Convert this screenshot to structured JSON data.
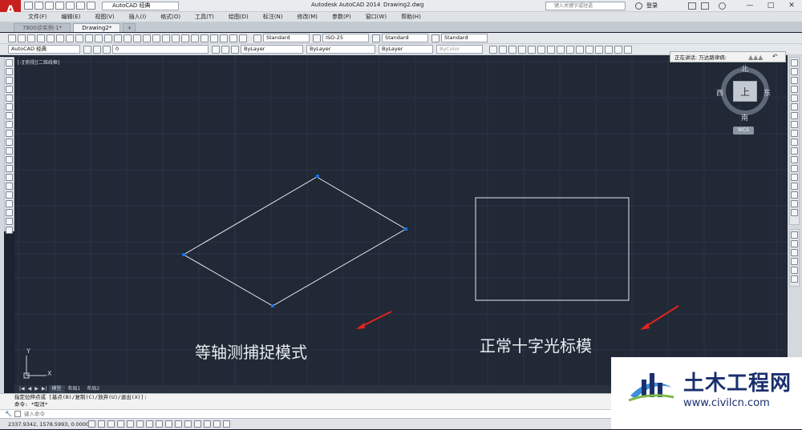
{
  "window": {
    "app_title": "Autodesk AutoCAD 2014",
    "file_title": "Drawing2.dwg",
    "logo_letter": "A",
    "workspace": "AutoCAD 经典",
    "search_placeholder": "键入关键字或短语",
    "login": "登录",
    "controls": {
      "minimize": "—",
      "maximize": "□",
      "close": "✕"
    }
  },
  "menu": {
    "items": [
      "文件(F)",
      "编辑(E)",
      "视图(V)",
      "插入(I)",
      "格式(O)",
      "工具(T)",
      "绘图(D)",
      "标注(N)",
      "修改(M)",
      "参数(P)",
      "窗口(W)",
      "帮助(H)"
    ]
  },
  "tabs": {
    "items": [
      {
        "label": "7800诊实例-1*",
        "active": false
      },
      {
        "label": "Drawing2*",
        "active": true
      }
    ]
  },
  "toolbar_styles": {
    "text_style": "Standard",
    "dim_style": "ISO-25",
    "table_style": "Standard",
    "mleader_style": "Standard"
  },
  "toolbar_layers": {
    "workspace": "AutoCAD 经典",
    "layer": "0",
    "color": "ByLayer",
    "linetype": "ByLayer",
    "lineweight": "ByLayer",
    "plotstyle": "ByColor",
    "dim_scale": "ISO-25"
  },
  "canvas": {
    "viewport_label": "[-][俯视][二维线框]",
    "background": "#212836",
    "line_color": "#e6e9ee",
    "grip_color": "#1e6fd6"
  },
  "viewcube": {
    "north": "北",
    "south": "南",
    "east": "东",
    "west": "西",
    "top": "上",
    "wcs": "WCS"
  },
  "tooltip": {
    "text": "正在讲话: 万达路律病:"
  },
  "annotations": {
    "left_caption": "等轴测捕捉模式",
    "right_caption": "正常十字光标模",
    "arrow_color": "#e0251c"
  },
  "ucs": {
    "x": "X",
    "y": "Y"
  },
  "layout_tabs": {
    "nav": [
      "|◀",
      "◀",
      "▶",
      "▶|"
    ],
    "items": [
      "模型",
      "布局1",
      "布局2"
    ]
  },
  "command_line": {
    "history": [
      "指定拉伸点或 [基点(B)/复制(C)/放弃(U)/退出(X)]:",
      "命令: *取消*"
    ],
    "placeholder": "键入命令"
  },
  "statusbar": {
    "coords": "2337.9342, 1578.5993, 0.0000"
  },
  "watermark": {
    "name": "土木工程网",
    "url": "www.civilcn.com",
    "color": "#1a2f6e",
    "accent": "#3b8fd6"
  }
}
